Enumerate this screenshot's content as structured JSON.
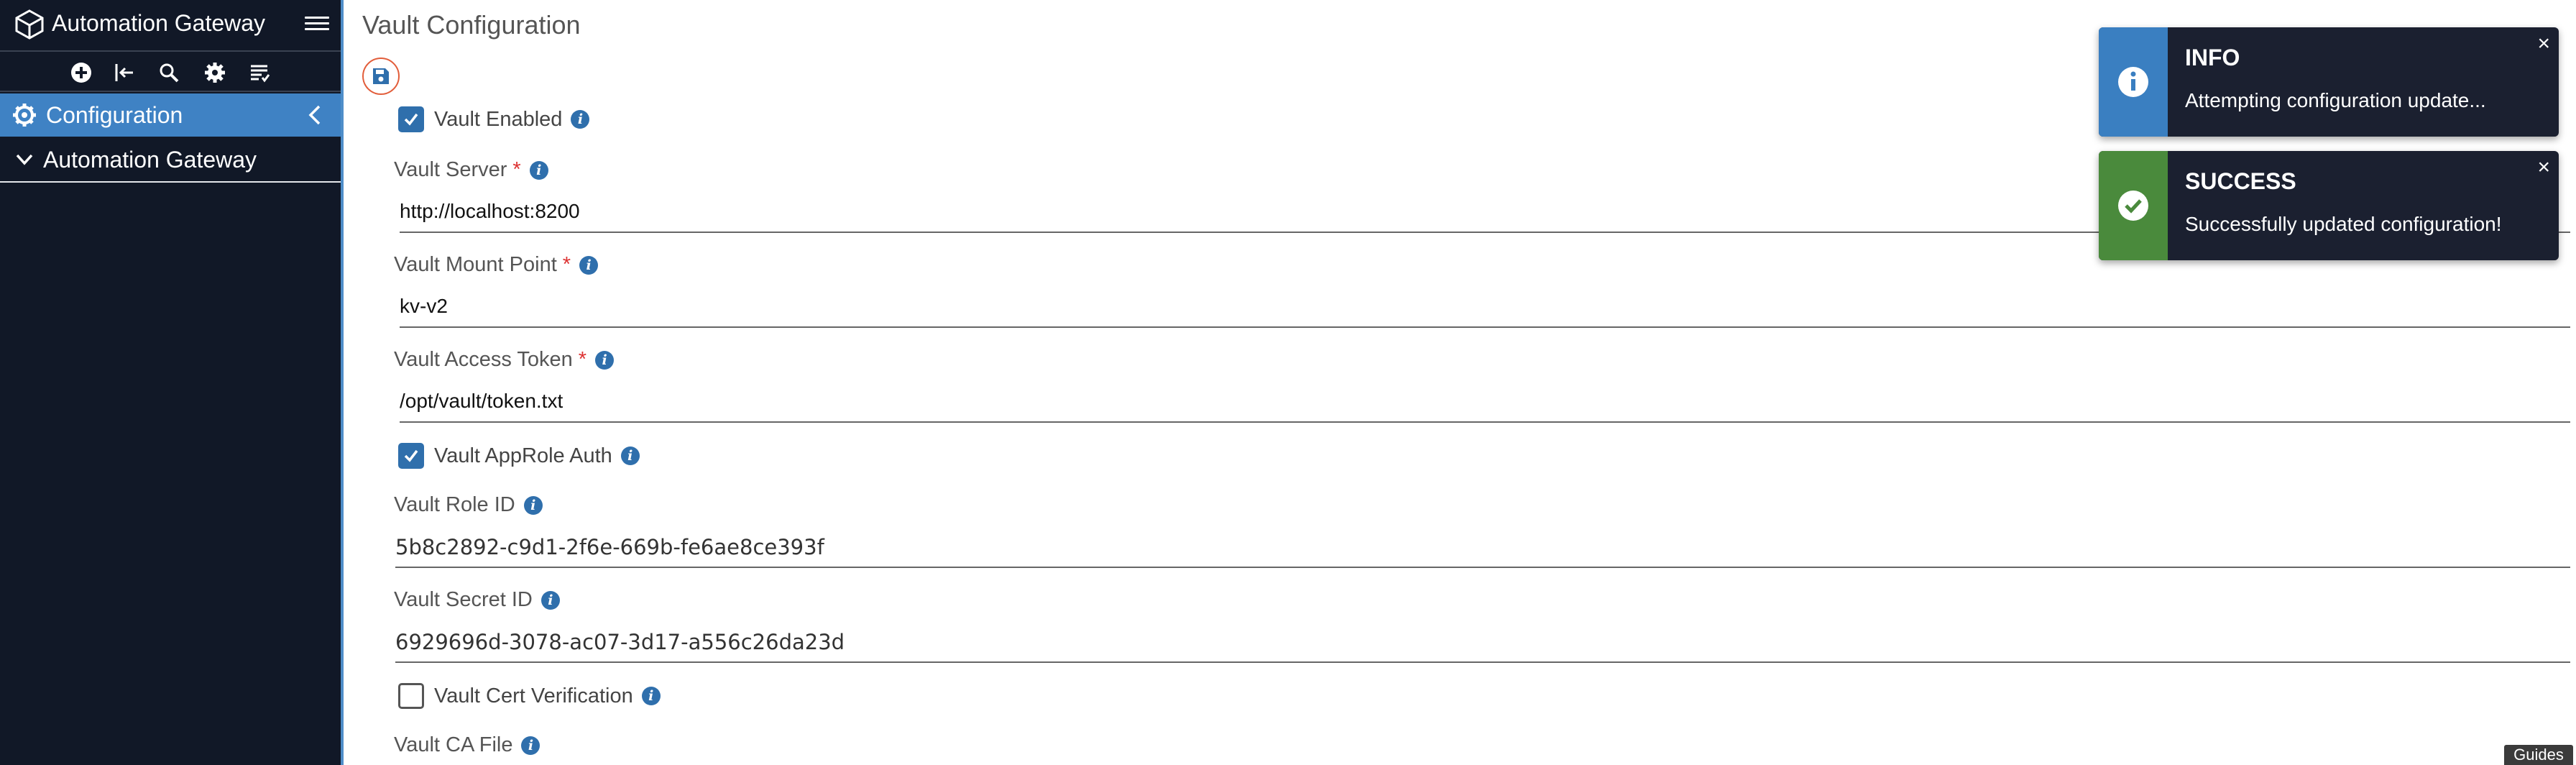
{
  "sidebar": {
    "app_title": "Automation Gateway",
    "toolbar": [
      {
        "icon": "add-circle-icon"
      },
      {
        "icon": "import-icon"
      },
      {
        "icon": "search-icon"
      },
      {
        "icon": "gear-icon"
      },
      {
        "icon": "list-icon"
      }
    ],
    "nav": [
      {
        "label": "Configuration",
        "icon": "gear-icon",
        "active": true
      },
      {
        "label": "Automation Gateway",
        "icon": "chevron-down-icon",
        "active": false
      }
    ]
  },
  "main": {
    "title": "Vault Configuration",
    "vault_enabled": {
      "label": "Vault Enabled",
      "checked": true
    },
    "vault_server": {
      "label": "Vault Server",
      "required": "*",
      "value": "http://localhost:8200"
    },
    "vault_mount_point": {
      "label": "Vault Mount Point",
      "required": "*",
      "value": "kv-v2"
    },
    "vault_access_token": {
      "label": "Vault Access Token",
      "required": "*",
      "value": "/opt/vault/token.txt"
    },
    "vault_approle_auth": {
      "label": "Vault AppRole Auth",
      "checked": true
    },
    "vault_role_id": {
      "label": "Vault Role ID",
      "value": "5b8c2892-c9d1-2f6e-669b-fe6ae8ce393f"
    },
    "vault_secret_id": {
      "label": "Vault Secret ID",
      "value": "6929696d-3078-ac07-3d17-a556c26da23d"
    },
    "vault_cert_verification": {
      "label": "Vault Cert Verification",
      "checked": false
    },
    "vault_ca_file": {
      "label": "Vault CA File"
    }
  },
  "toasts": [
    {
      "title": "INFO",
      "message": "Attempting configuration update...",
      "color": "#3a7fc1",
      "icon": "info-icon"
    },
    {
      "title": "SUCCESS",
      "message": "Successfully updated configuration!",
      "color": "#4a8a3c",
      "icon": "check-circle-icon"
    }
  ],
  "guides_label": "Guides",
  "colors": {
    "sidebar_bg": "#111827",
    "accent": "#3f82c4",
    "checkbox": "#2f6fac",
    "required": "#dd3333"
  }
}
